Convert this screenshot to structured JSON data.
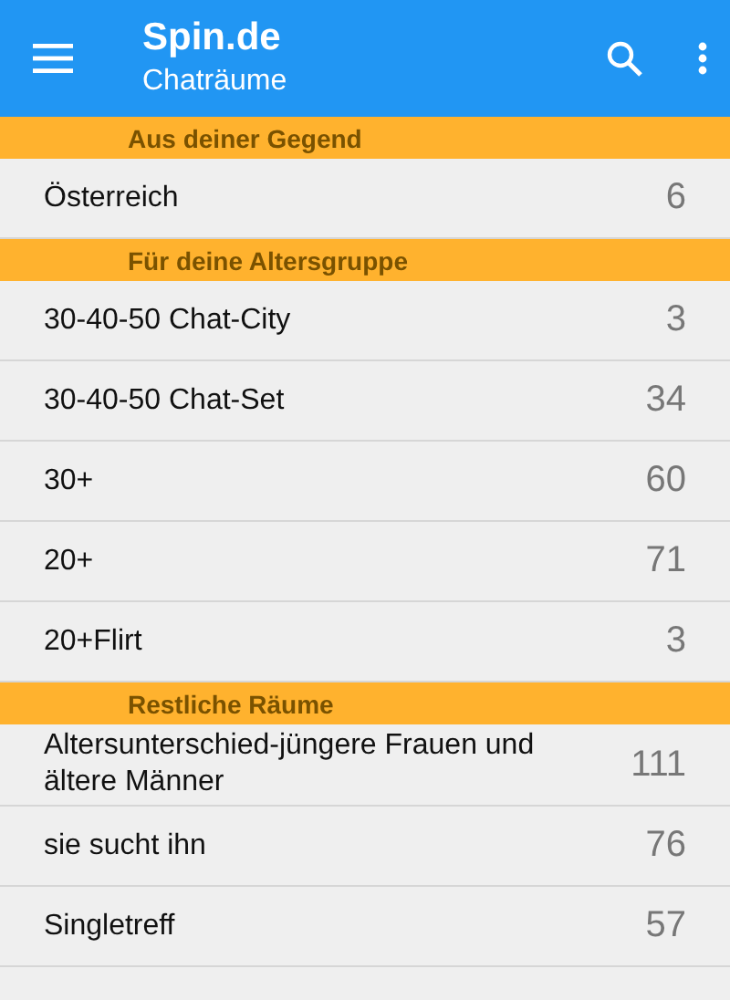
{
  "app_bar": {
    "title": "Spin.de",
    "subtitle": "Chaträume"
  },
  "sections": [
    {
      "title": "Aus deiner Gegend",
      "rooms": [
        {
          "name": "Österreich",
          "count": "6"
        }
      ]
    },
    {
      "title": "Für deine Altersgruppe",
      "rooms": [
        {
          "name": "30-40-50 Chat-City",
          "count": "3"
        },
        {
          "name": "30-40-50 Chat-Set",
          "count": "34"
        },
        {
          "name": "30+",
          "count": "60"
        },
        {
          "name": "20+",
          "count": "71"
        },
        {
          "name": "20+Flirt",
          "count": "3"
        }
      ]
    },
    {
      "title": "Restliche Räume",
      "rooms": [
        {
          "name": "Altersunterschied-jüngere Frauen und ältere Männer",
          "count": "111"
        },
        {
          "name": "sie sucht ihn",
          "count": "76"
        },
        {
          "name": "Singletreff",
          "count": "57"
        }
      ]
    }
  ]
}
